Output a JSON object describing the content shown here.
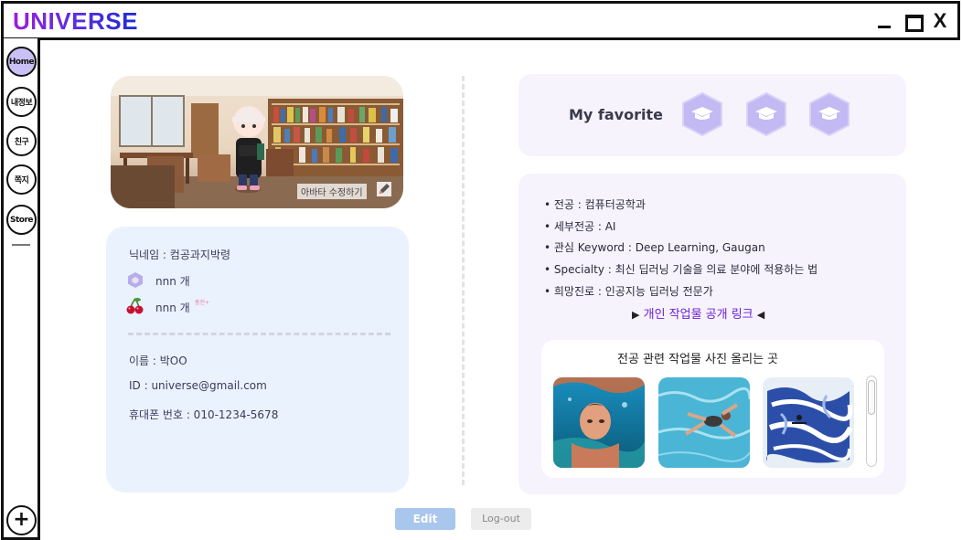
{
  "window": {
    "title": "UNIVERSE",
    "close_label": "X"
  },
  "sidebar": {
    "items": [
      {
        "label": "Home",
        "active": true
      },
      {
        "label": "내정보",
        "active": false
      },
      {
        "label": "친구",
        "active": false
      },
      {
        "label": "쪽지",
        "active": false
      },
      {
        "label": "Store",
        "active": false
      }
    ],
    "add_label": "+"
  },
  "avatar": {
    "edit_label": "아바타 수정하기",
    "edit_icon": "pencil-icon"
  },
  "profile": {
    "nickname": "닉네임 : 컴공과지박령",
    "coin_count": "nnn 개",
    "cherry_count": "nnn 개",
    "charge_label": "충전+",
    "name": "이름 : 박OO",
    "id": "ID : universe@gmail.com",
    "phone": "휴대폰 번호 : 010-1234-5678"
  },
  "favorite": {
    "label": "My favorite",
    "slots": [
      "graduation-cap-icon",
      "graduation-cap-icon",
      "graduation-cap-icon"
    ],
    "hex_color": "#c3b9f3"
  },
  "major": {
    "lines": [
      "• 전공 : 컴퓨터공학과",
      "• 세부전공 : AI",
      "• 관심 Keyword : Deep Learning, Gaugan",
      "• Specialty : 최신 딥러닝 기술을 의료 분야에 적용하는 법",
      "• 희망진로 : 인공지능 딥러닝 전문가"
    ],
    "link_label": "개인 작업물 공개 링크",
    "link_color": "#6d1fd6"
  },
  "gallery": {
    "title": "전공 관련 작업물 사진 올리는 곳"
  },
  "actions": {
    "edit_label": "Edit",
    "logout_label": "Log-out"
  }
}
